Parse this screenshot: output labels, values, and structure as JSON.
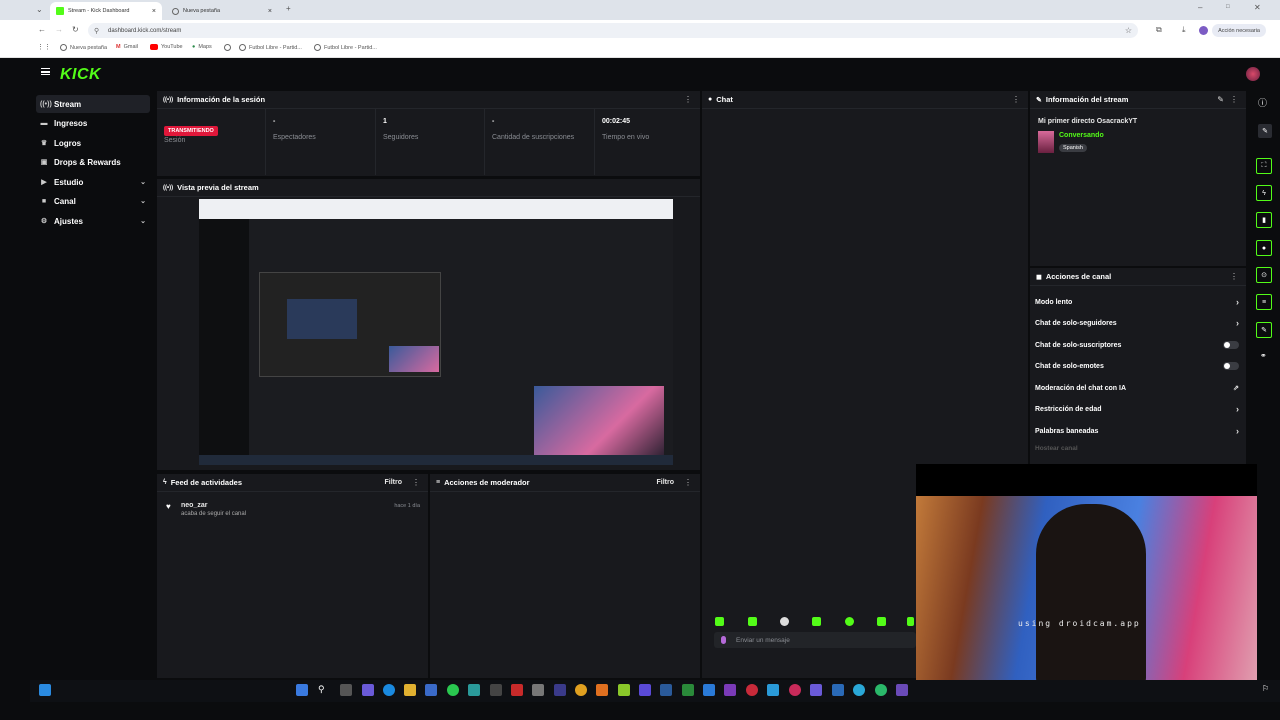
{
  "browser": {
    "tabs": [
      {
        "title": "Stream - Kick Dashboard",
        "active": true
      },
      {
        "title": "Nueva pestaña",
        "active": false
      }
    ],
    "url": "dashboard.kick.com/stream",
    "action_button": "Acción necesaria",
    "bookmarks": [
      "Nueva pestaña",
      "Gmail",
      "YouTube",
      "Maps",
      "Futbol Libre - Partid...",
      "Futbol Libre - Partid..."
    ]
  },
  "brand": {
    "logo": "KICK",
    "accent": "#53fc18"
  },
  "sidebar": {
    "items": [
      {
        "label": "Stream",
        "icon": "broadcast-icon",
        "active": true,
        "expand": false
      },
      {
        "label": "Ingresos",
        "icon": "wallet-icon",
        "active": false,
        "expand": false
      },
      {
        "label": "Logros",
        "icon": "trophy-icon",
        "active": false,
        "expand": false
      },
      {
        "label": "Drops & Rewards",
        "icon": "gift-icon",
        "active": false,
        "expand": false
      },
      {
        "label": "Estudio",
        "icon": "camera-icon",
        "active": false,
        "expand": true
      },
      {
        "label": "Canal",
        "icon": "folder-icon",
        "active": false,
        "expand": true
      },
      {
        "label": "Ajustes",
        "icon": "gear-icon",
        "active": false,
        "expand": true
      }
    ]
  },
  "session": {
    "title": "Información de la sesión",
    "badge": "TRANSMITIENDO",
    "badge_sub": "Sesión",
    "stats": [
      {
        "value": "-",
        "label": "Espectadores"
      },
      {
        "value": "1",
        "label": "Seguidores"
      },
      {
        "value": "-",
        "label": "Cantidad de suscripciones"
      },
      {
        "value": "00:02:45",
        "label": "Tiempo en vivo"
      }
    ]
  },
  "preview": {
    "title": "Vista previa del stream"
  },
  "chat": {
    "title": "Chat",
    "placeholder": "Enviar un mensaje"
  },
  "stream_info": {
    "title": "Información del stream",
    "stream_title": "Mi primer directo OsacrackYT",
    "category": "Conversando",
    "language": "Spanish"
  },
  "channel_actions": {
    "title": "Acciones de canal",
    "rows": [
      {
        "label": "Modo lento",
        "control": "arrow"
      },
      {
        "label": "Chat de solo-seguidores",
        "control": "arrow"
      },
      {
        "label": "Chat de solo-suscriptores",
        "control": "toggle"
      },
      {
        "label": "Chat de solo-emotes",
        "control": "toggle"
      },
      {
        "label": "Moderación del chat con IA",
        "control": "external"
      },
      {
        "label": "Restricción de edad",
        "control": "arrow"
      },
      {
        "label": "Palabras baneadas",
        "control": "arrow"
      }
    ],
    "faded": "Hostear canal"
  },
  "feed": {
    "title": "Feed de actividades",
    "filter": "Filtro",
    "items": [
      {
        "user": "neo_zar",
        "text": "acaba de seguir el canal",
        "time": "hace 1 día"
      }
    ]
  },
  "moderator": {
    "title": "Acciones de moderador",
    "filter": "Filtro"
  },
  "webcam": {
    "overlay_text": "using droidcam.app"
  }
}
